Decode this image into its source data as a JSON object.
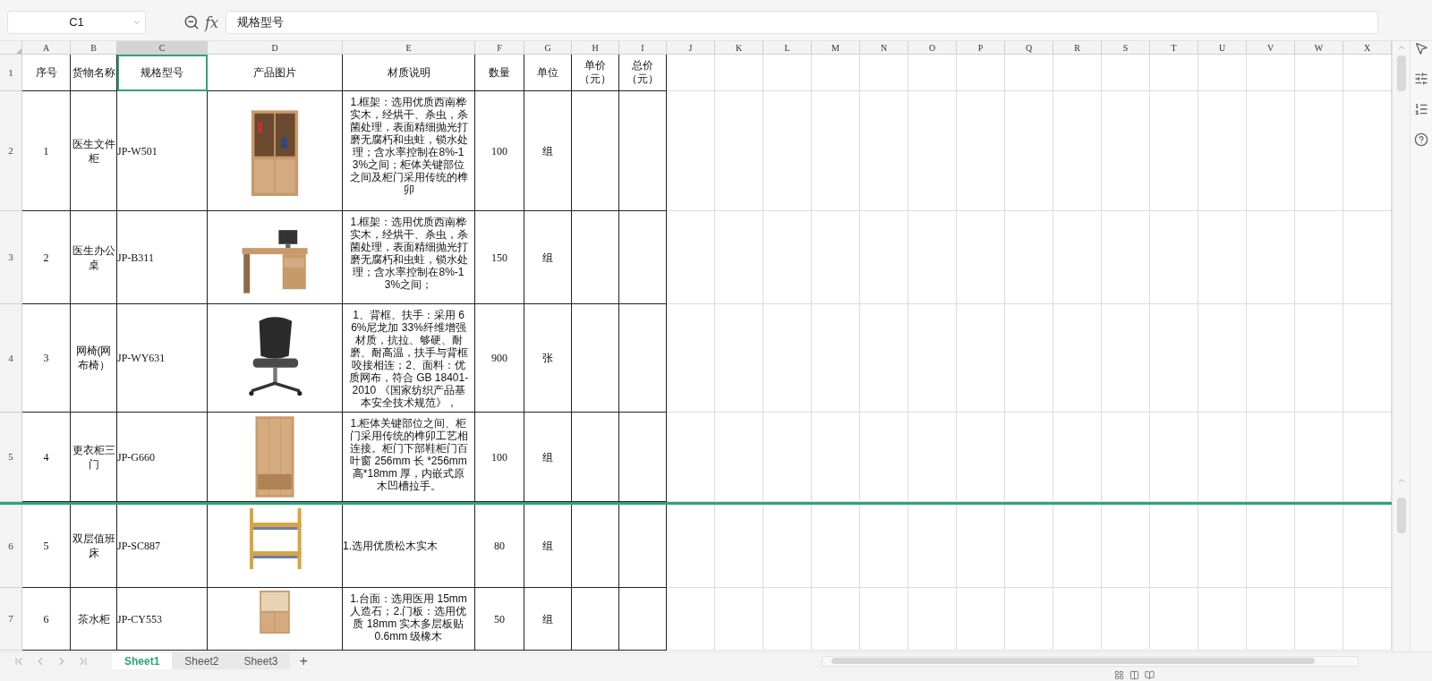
{
  "name_box": {
    "value": "C1"
  },
  "formula_bar": {
    "fx_label": "fx",
    "value": "规格型号"
  },
  "column_headers": [
    {
      "label": "A",
      "selected": false
    },
    {
      "label": "B",
      "selected": false
    },
    {
      "label": "C",
      "selected": true
    },
    {
      "label": "D",
      "selected": false
    },
    {
      "label": "E",
      "selected": false
    },
    {
      "label": "F",
      "selected": false
    },
    {
      "label": "G",
      "selected": false
    },
    {
      "label": "H",
      "selected": false
    },
    {
      "label": "I",
      "selected": false
    },
    {
      "label": "J",
      "selected": false
    },
    {
      "label": "K",
      "selected": false
    },
    {
      "label": "L",
      "selected": false
    },
    {
      "label": "M",
      "selected": false
    },
    {
      "label": "N",
      "selected": false
    },
    {
      "label": "O",
      "selected": false
    },
    {
      "label": "P",
      "selected": false
    },
    {
      "label": "Q",
      "selected": false
    },
    {
      "label": "R",
      "selected": false
    },
    {
      "label": "S",
      "selected": false
    },
    {
      "label": "T",
      "selected": false
    },
    {
      "label": "U",
      "selected": false
    },
    {
      "label": "V",
      "selected": false
    },
    {
      "label": "W",
      "selected": false
    },
    {
      "label": "X",
      "selected": false
    }
  ],
  "header_row": {
    "number": "1",
    "cells": [
      "序号",
      "货物名称",
      "规格型号",
      "产品图片",
      "材质说明",
      "数量",
      "单位",
      "单价（元）",
      "总价（元）"
    ]
  },
  "rows": [
    {
      "number": "2",
      "seq": "1",
      "name": "医生文件柜",
      "model": "JP-W501",
      "description": "1.框架：选用优质西南桦实木，经烘干、杀虫，杀菌处理，表面精细抛光打磨无腐朽和虫蛀，锁水处理；含水率控制在8%-13%之间；柜体关键部位之间及柜门采用传统的榫卯",
      "quantity": "100",
      "unit": "组"
    },
    {
      "number": "3",
      "seq": "2",
      "name": "医生办公桌",
      "model": "JP-B311",
      "description": "1.框架：选用优质西南桦实木，经烘干、杀虫，杀菌处理，表面精细抛光打磨无腐朽和虫蛀，锁水处理；含水率控制在8%-13%之间；",
      "quantity": "150",
      "unit": "组"
    },
    {
      "number": "4",
      "seq": "3",
      "name": "网椅(网布椅）",
      "model": "JP-WY631",
      "description": "1、背框、扶手：采用 66%尼龙加 33%纤维增强材质，抗拉、够硬、耐磨、耐高温，扶手与背框咬接相连；2、面料：优质网布，符合 GB 18401-2010 《国家纺织产品基本安全技术规范》，",
      "quantity": "900",
      "unit": "张"
    },
    {
      "number": "5",
      "seq": "4",
      "name": "更衣柜三门",
      "model": "JP-G660",
      "description": "1.柜体关键部位之间、柜门采用传统的榫卯工艺相连接。柜门下部鞋柜门百叶窗 256mm 长 *256mm 高*18mm 厚，内嵌式原木凹槽拉手。",
      "quantity": "100",
      "unit": "组"
    },
    {
      "number": "6",
      "seq": "5",
      "name": "双层值班床",
      "model": "JP-SC887",
      "description": "1.选用优质松木实木",
      "quantity": "80",
      "unit": "组"
    },
    {
      "number": "7",
      "seq": "6",
      "name": "茶水柜",
      "model": "JP-CY553",
      "description": "1.台面：选用医用 15mm 人造石；2.门板：选用优质 18mm 实木多层板贴 0.6mm 级橡木",
      "quantity": "50",
      "unit": "组"
    }
  ],
  "sheet_tabs": [
    {
      "label": "Sheet1",
      "selected": true
    },
    {
      "label": "Sheet2",
      "selected": false
    },
    {
      "label": "Sheet3",
      "selected": false
    }
  ],
  "add_sheet": {
    "label": "+"
  }
}
